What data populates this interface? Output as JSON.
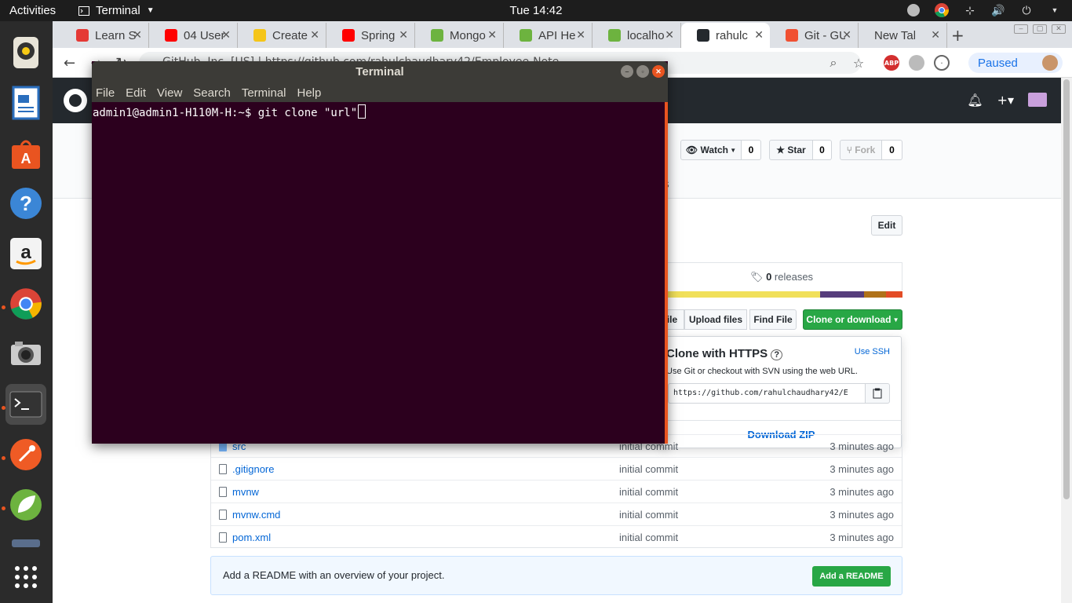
{
  "topbar": {
    "activities": "Activities",
    "app_name": "Terminal",
    "clock": "Tue 14:42"
  },
  "browser": {
    "tabs": [
      {
        "title": "Learn S",
        "color": "#e53935"
      },
      {
        "title": "04 User",
        "color": "#ff0000"
      },
      {
        "title": "Create",
        "color": "#f5c518"
      },
      {
        "title": "Spring",
        "color": "#ff0000"
      },
      {
        "title": "Mongo",
        "color": "#6db33f"
      },
      {
        "title": "API He",
        "color": "#6db33f"
      },
      {
        "title": "localho",
        "color": "#6db33f"
      },
      {
        "title": "rahulc",
        "color": "#24292e"
      },
      {
        "title": "Git - GU",
        "color": "#f05032"
      },
      {
        "title": "New Tab",
        "color": ""
      }
    ],
    "new_tab_symbol": "+",
    "url_partial": "GitHub, Inc. [US]  |  https://github.com/rahulchaudhary42/Employee-Note",
    "paused_label": "Paused",
    "abp_label": "ABP"
  },
  "github": {
    "watch_label": "Watch",
    "watch_count": "0",
    "star_label": "Star",
    "star_count": "0",
    "fork_label": "Fork",
    "fork_count": "0",
    "partial_tab_text": "s",
    "edit_label": "Edit",
    "releases_count": "0",
    "releases_label": "releases",
    "create_file_partial": "ile",
    "upload_label": "Upload files",
    "find_label": "Find File",
    "clone_label": "Clone or download",
    "clone_popup": {
      "title": "Clone with HTTPS",
      "use_ssh": "Use SSH",
      "description": "Use Git or checkout with SVN using the web URL.",
      "url": "https://github.com/rahulchaudhary42/E",
      "download_zip": "Download ZIP"
    },
    "files": [
      {
        "name": "src",
        "message": "initial commit",
        "time": "3 minutes ago",
        "dir": true
      },
      {
        "name": ".gitignore",
        "message": "initial commit",
        "time": "3 minutes ago",
        "dir": false
      },
      {
        "name": "mvnw",
        "message": "initial commit",
        "time": "3 minutes ago",
        "dir": false
      },
      {
        "name": "mvnw.cmd",
        "message": "initial commit",
        "time": "3 minutes ago",
        "dir": false
      },
      {
        "name": "pom.xml",
        "message": "initial commit",
        "time": "3 minutes ago",
        "dir": false
      }
    ],
    "readme_prompt": "Add a README with an overview of your project.",
    "readme_button": "Add a README",
    "lang_colors": [
      "#f1e05a",
      "#563d7c",
      "#b07219",
      "#e34c26"
    ]
  },
  "terminal": {
    "title": "Terminal",
    "menu": [
      "File",
      "Edit",
      "View",
      "Search",
      "Terminal",
      "Help"
    ],
    "prompt": "admin1@admin1-H110M-H:~$ ",
    "command": "git clone \"url\""
  }
}
